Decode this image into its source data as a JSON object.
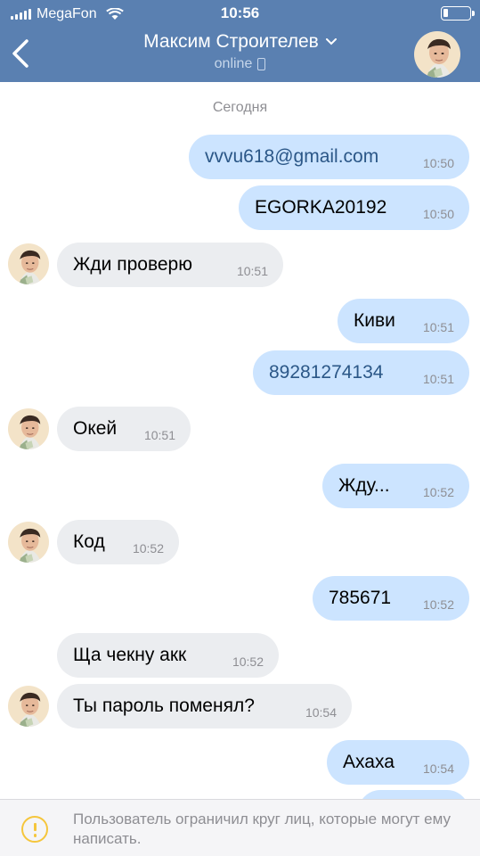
{
  "status_bar": {
    "carrier": "MegaFon",
    "time": "10:56"
  },
  "header": {
    "title": "Максим Строителев",
    "status": "online"
  },
  "day_label": "Сегодня",
  "messages": [
    {
      "dir": "out",
      "text": "vvvu618@gmail.com",
      "time": "10:50"
    },
    {
      "dir": "out",
      "text": "EGORKA20192",
      "time": "10:50"
    },
    {
      "dir": "in",
      "text": "Жди проверю",
      "time": "10:51"
    },
    {
      "dir": "out",
      "text": "Киви",
      "time": "10:51"
    },
    {
      "dir": "out",
      "text": "89281274134",
      "time": "10:51"
    },
    {
      "dir": "in",
      "text": "Окей",
      "time": "10:51"
    },
    {
      "dir": "out",
      "text": "Жду...",
      "time": "10:52"
    },
    {
      "dir": "in",
      "text": "Код",
      "time": "10:52"
    },
    {
      "dir": "out",
      "text": "785671",
      "time": "10:52"
    },
    {
      "dir": "in",
      "text": "Ща чекну акк",
      "time": "10:52"
    },
    {
      "dir": "in",
      "text": "Ты пароль поменял?",
      "time": "10:54"
    },
    {
      "dir": "out",
      "text": "Ахаха",
      "time": "10:54"
    }
  ],
  "footer": {
    "notice": "Пользователь ограничил круг лиц, которые могут ему написать."
  },
  "colors": {
    "header": "#5a80b1",
    "outgoing": "#cce4ff",
    "incoming": "#ebedf0",
    "link": "#2b5787",
    "warning": "#f5c63c"
  }
}
